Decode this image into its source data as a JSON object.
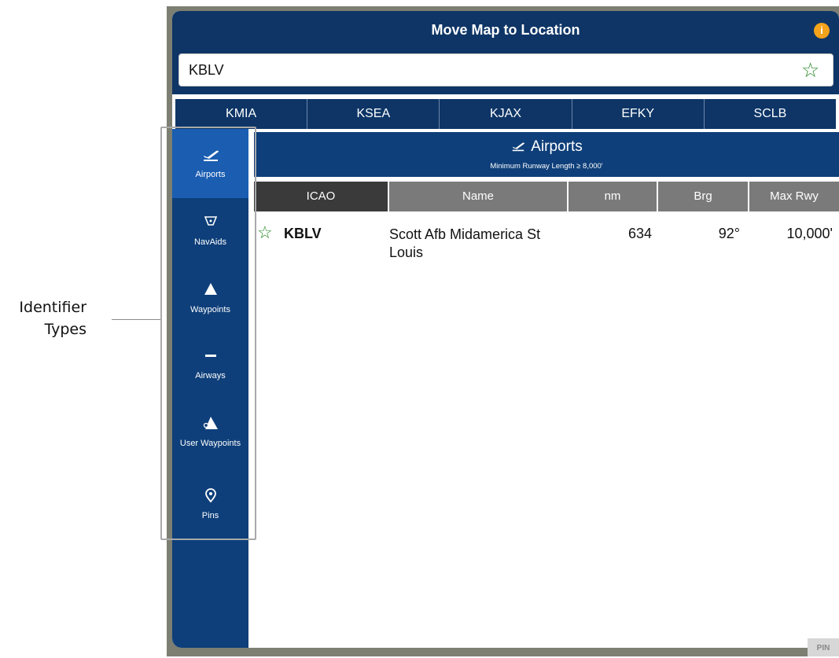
{
  "annotation": {
    "line1": "Identifier",
    "line2": "Types"
  },
  "window": {
    "title": "Move Map to Location",
    "info_icon": "info-icon"
  },
  "search": {
    "value": "KBLV",
    "favorite_icon": "star-outline-icon"
  },
  "recents": [
    "KMIA",
    "KSEA",
    "KJAX",
    "EFKY",
    "SCLB"
  ],
  "sidebar": {
    "items": [
      {
        "label": "Airports",
        "icon": "plane-departure-icon",
        "active": true
      },
      {
        "label": "NavAids",
        "icon": "vor-icon"
      },
      {
        "label": "Waypoints",
        "icon": "triangle-icon"
      },
      {
        "label": "Airways",
        "icon": "airway-icon"
      },
      {
        "label": "User Waypoints",
        "icon": "user-waypoint-icon"
      },
      {
        "label": "Pins",
        "icon": "pin-icon"
      }
    ]
  },
  "results": {
    "title": "Airports",
    "subtitle": "Minimum Runway Length ≥ 8,000'",
    "columns": [
      "ICAO",
      "Name",
      "nm",
      "Brg",
      "Max Rwy"
    ],
    "rows": [
      {
        "icao": "KBLV",
        "name": "Scott Afb Midamerica St Louis",
        "nm": "634",
        "brg": "92°",
        "max_rwy": "10,000'"
      }
    ]
  },
  "corner_tag": "PIN",
  "colors": {
    "title_bar": "#0e3566",
    "sidebar": "#0e3f7a",
    "sidebar_active": "#1a5db1",
    "info_icon": "#f3a21b",
    "star": "#2a8a2a"
  }
}
